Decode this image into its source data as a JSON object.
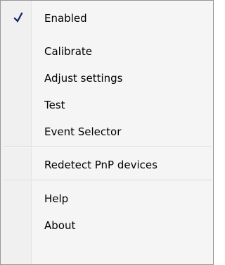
{
  "menu": {
    "items": [
      {
        "label": "Enabled",
        "checked": true,
        "icon": "checkmark-icon"
      },
      {
        "label": "Calibrate"
      },
      {
        "label": "Adjust settings"
      },
      {
        "label": "Test"
      },
      {
        "label": "Event Selector"
      },
      {
        "label": "Redetect PnP devices"
      },
      {
        "label": "Help"
      },
      {
        "label": "About"
      }
    ]
  },
  "colors": {
    "menu_background": "#f5f5f5",
    "menu_border": "#979797",
    "separator": "#d0d0d0",
    "checkmark": "#0a246a"
  }
}
